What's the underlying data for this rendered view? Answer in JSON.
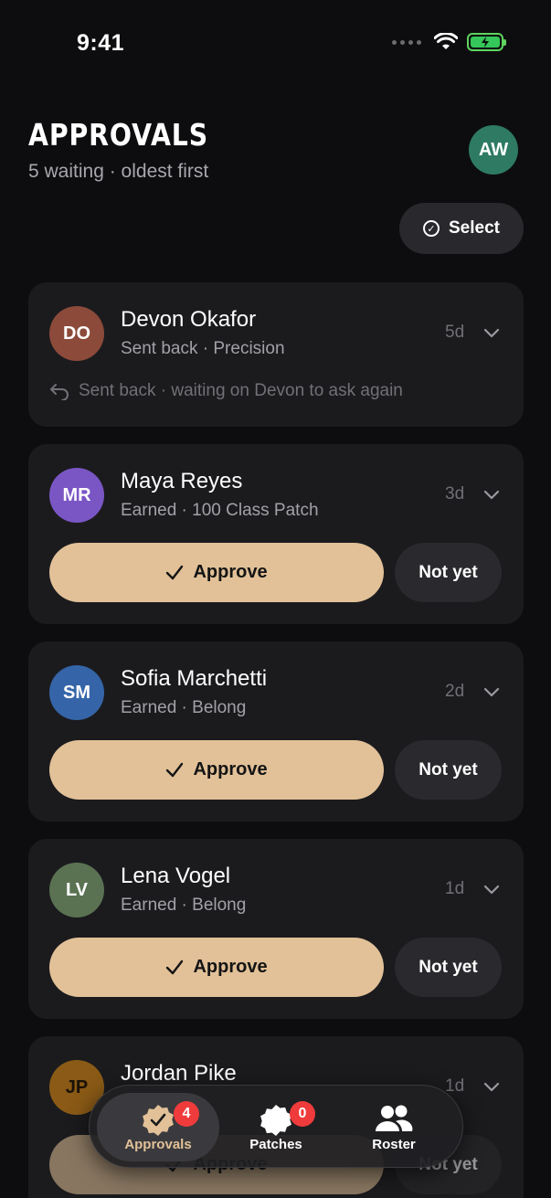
{
  "status_bar": {
    "time": "9:41"
  },
  "header": {
    "title": "APPROVALS",
    "subtitle": "5 waiting · oldest first",
    "user_initials": "AW",
    "select_label": "Select"
  },
  "colors": {
    "accent": "#e2c198",
    "background": "#0d0d0f",
    "card": "#1b1b1e",
    "badge": "#ef3b3b"
  },
  "approvals": [
    {
      "initials": "DO",
      "name": "Devon Okafor",
      "subtitle": "Sent back · Precision",
      "age": "5d",
      "avatar_color": "#8c4a3a",
      "note": "Sent back · waiting on Devon to ask again"
    },
    {
      "initials": "MR",
      "name": "Maya Reyes",
      "subtitle": "Earned · 100 Class Patch",
      "age": "3d",
      "avatar_color": "#7a56c4",
      "approve_label": "Approve",
      "not_yet_label": "Not yet"
    },
    {
      "initials": "SM",
      "name": "Sofia Marchetti",
      "subtitle": "Earned · Belong",
      "age": "2d",
      "avatar_color": "#3565a8",
      "approve_label": "Approve",
      "not_yet_label": "Not yet"
    },
    {
      "initials": "LV",
      "name": "Lena Vogel",
      "subtitle": "Earned · Belong",
      "age": "1d",
      "avatar_color": "#5a7252",
      "approve_label": "Approve",
      "not_yet_label": "Not yet"
    },
    {
      "initials": "JP",
      "name": "Jordan Pike",
      "age": "1d",
      "avatar_color": "#8a5a16",
      "approve_label": "Approve",
      "not_yet_label": "Not yet"
    }
  ],
  "tabbar": {
    "tabs": [
      {
        "label": "Approvals",
        "icon": "seal-check-icon",
        "badge": "4"
      },
      {
        "label": "Patches",
        "icon": "patch-icon",
        "badge": "0"
      },
      {
        "label": "Roster",
        "icon": "people-icon"
      }
    ]
  }
}
